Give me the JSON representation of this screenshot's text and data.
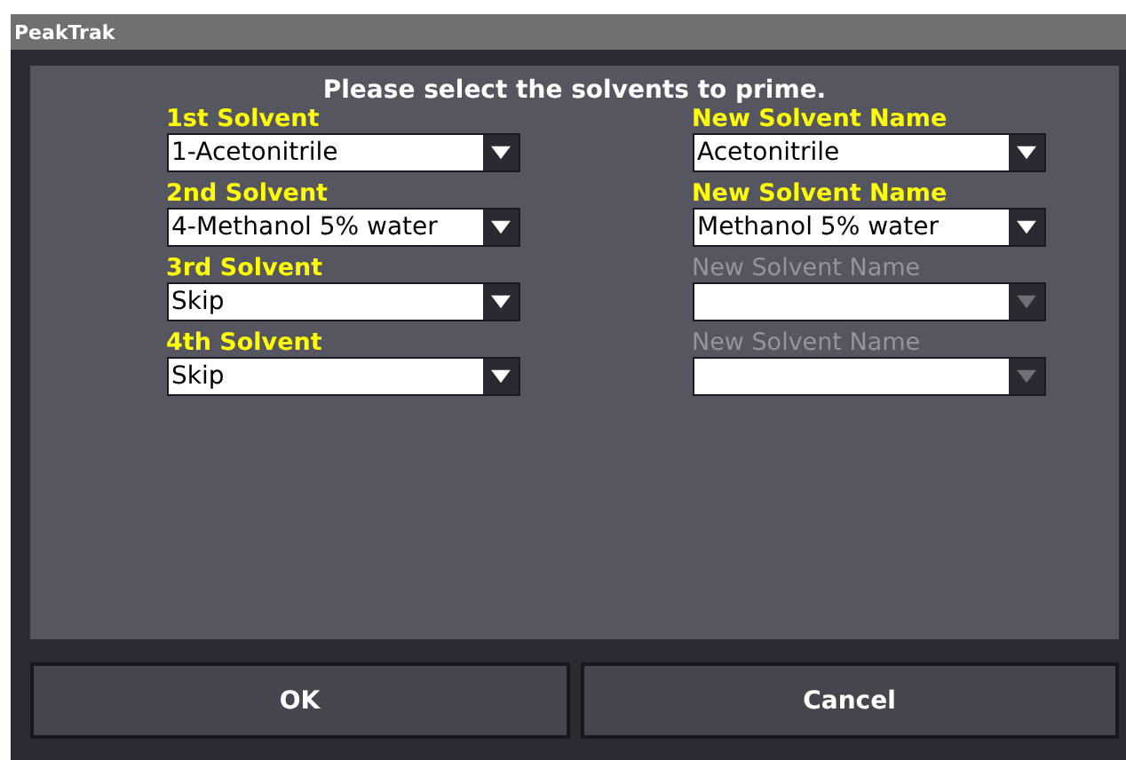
{
  "window": {
    "title": "PeakTrak"
  },
  "prompt": "Please select the solvents to prime.",
  "rows": [
    {
      "solvent": {
        "label": "1st Solvent",
        "value": "1-Acetonitrile",
        "disabled": false
      },
      "new_name": {
        "label": "New Solvent Name",
        "value": "Acetonitrile",
        "disabled": false
      }
    },
    {
      "solvent": {
        "label": "2nd Solvent",
        "value": "4-Methanol 5% water",
        "disabled": false
      },
      "new_name": {
        "label": "New Solvent Name",
        "value": "Methanol 5% water",
        "disabled": false
      }
    },
    {
      "solvent": {
        "label": "3rd Solvent",
        "value": "Skip",
        "disabled": false
      },
      "new_name": {
        "label": "New Solvent Name",
        "disabled": true
      }
    },
    {
      "solvent": {
        "label": "4th Solvent",
        "value": "Skip",
        "disabled": false
      },
      "new_name": {
        "label": "New Solvent Name",
        "disabled": true
      }
    }
  ],
  "buttons": [
    "OK",
    "Cancel"
  ]
}
